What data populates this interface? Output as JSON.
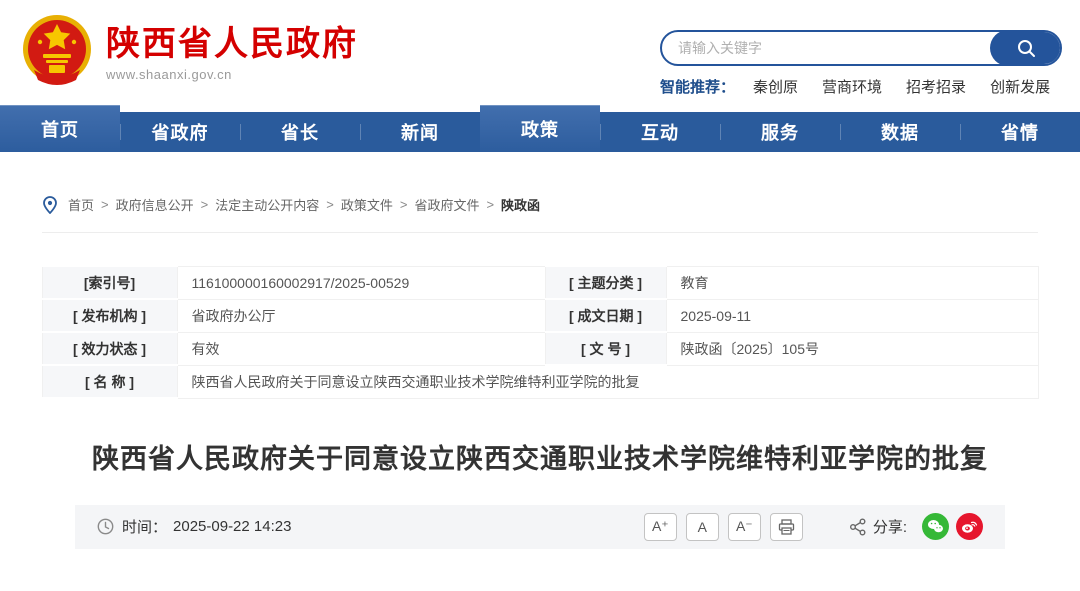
{
  "header": {
    "site_name": "陕西省人民政府",
    "site_url": "www.shaanxi.gov.cn",
    "search": {
      "placeholder": "请输入关键字"
    },
    "recommend": {
      "label": "智能推荐：",
      "links": [
        "秦创原",
        "营商环境",
        "招考招录",
        "创新发展"
      ]
    }
  },
  "nav": {
    "items": [
      {
        "label": "首页",
        "active": true
      },
      {
        "label": "省政府",
        "active": false
      },
      {
        "label": "省长",
        "active": false
      },
      {
        "label": "新闻",
        "active": false
      },
      {
        "label": "政策",
        "active": true
      },
      {
        "label": "互动",
        "active": false
      },
      {
        "label": "服务",
        "active": false
      },
      {
        "label": "数据",
        "active": false
      },
      {
        "label": "省情",
        "active": false
      }
    ]
  },
  "breadcrumb": {
    "separator": ">",
    "items": [
      "首页",
      "政府信息公开",
      "法定主动公开内容",
      "政策文件",
      "省政府文件",
      "陕政函"
    ]
  },
  "meta_table": {
    "rows": [
      {
        "label_left": "[索引号]",
        "value_left": "116100000160002917/2025-00529",
        "label_right": "[ 主题分类 ]",
        "value_right": "教育"
      },
      {
        "label_left": "[ 发布机构 ]",
        "value_left": "省政府办公厅",
        "label_right": "[ 成文日期 ]",
        "value_right": "2025-09-11"
      },
      {
        "label_left": "[ 效力状态 ]",
        "value_left": "有效",
        "label_right": "[ 文 号 ]",
        "value_right": "陕政函〔2025〕105号"
      },
      {
        "label_left": "[ 名 称 ]",
        "value_left": "陕西省人民政府关于同意设立陕西交通职业技术学院维特利亚学院的批复"
      }
    ]
  },
  "article": {
    "title": "陕西省人民政府关于同意设立陕西交通职业技术学院维特利亚学院的批复",
    "time_label": "时间：",
    "time_value": "2025-09-22 14:23",
    "font_buttons": [
      "A⁺",
      "A",
      "A⁻"
    ],
    "share_label": "分享:"
  },
  "colors": {
    "brand_red": "#d40000",
    "nav_blue": "#2a5b9c",
    "link_navy": "#1f4e8c",
    "wechat_green": "#35b837",
    "weibo_red": "#e6162d"
  }
}
